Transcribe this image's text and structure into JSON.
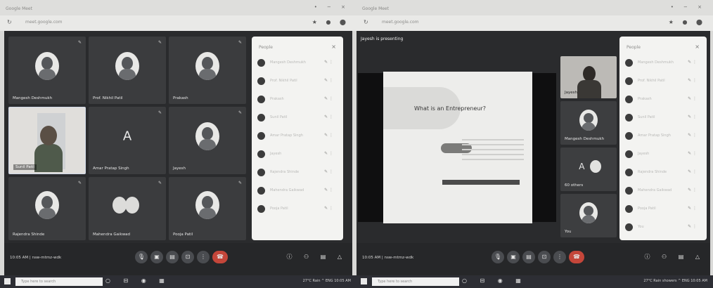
{
  "left": {
    "browser": {
      "tab_title": "Google Meet",
      "url": "meet.google.com"
    },
    "tiles": [
      {
        "name": "Mangesh Deshmukh"
      },
      {
        "name": "Prof. Nikhil Patil"
      },
      {
        "name": "Prakash"
      },
      {
        "name": "Sunil Patil"
      },
      {
        "name": "Amar Pratap Singh"
      },
      {
        "name": "Jayesh"
      },
      {
        "name": "Rajendra Shinde"
      },
      {
        "name": "Mahendra Gaikwad"
      },
      {
        "name": "Pooja Patil"
      }
    ],
    "people_panel": {
      "title": "People",
      "close": "×"
    },
    "participants": [
      "Mangesh Deshmukh",
      "Prof. Nikhil Patil",
      "Prakash",
      "Sunil Patil",
      "Amar Pratap Singh",
      "Jayesh",
      "Rajendra Shinde",
      "Mahendra Gaikwad",
      "Pooja Patil"
    ],
    "toolbar": {
      "meeting_info": "10:05 AM | nsw-mtmz-wdk"
    },
    "taskbar": {
      "search": "Type here to search",
      "tray": "27°C Rain ^ ENG 10:05 AM"
    }
  },
  "right": {
    "browser": {
      "tab_title": "Google Meet",
      "url": "meet.google.com"
    },
    "presenting_label": "Jayesh is presenting",
    "slide_title": "What is an Entrepreneur?",
    "side_tiles": [
      {
        "name": "Jayesh"
      },
      {
        "name": "Mangesh Deshmukh"
      },
      {
        "name": "60 others",
        "letter": "A"
      },
      {
        "name": "You"
      }
    ],
    "people_panel": {
      "title": "People",
      "close": "×"
    },
    "participants": [
      "Mangesh Deshmukh",
      "Prof. Nikhil Patil",
      "Prakash",
      "Sunil Patil",
      "Amar Pratap Singh",
      "Jayesh",
      "Rajendra Shinde",
      "Mahendra Gaikwad",
      "Pooja Patil",
      "You"
    ],
    "toolbar": {
      "meeting_info": "10:05 AM | nsw-mtmz-wdk"
    },
    "taskbar": {
      "search": "Type here to search",
      "tray": "27°C Rain showers ^ ENG 10:05 AM"
    }
  }
}
